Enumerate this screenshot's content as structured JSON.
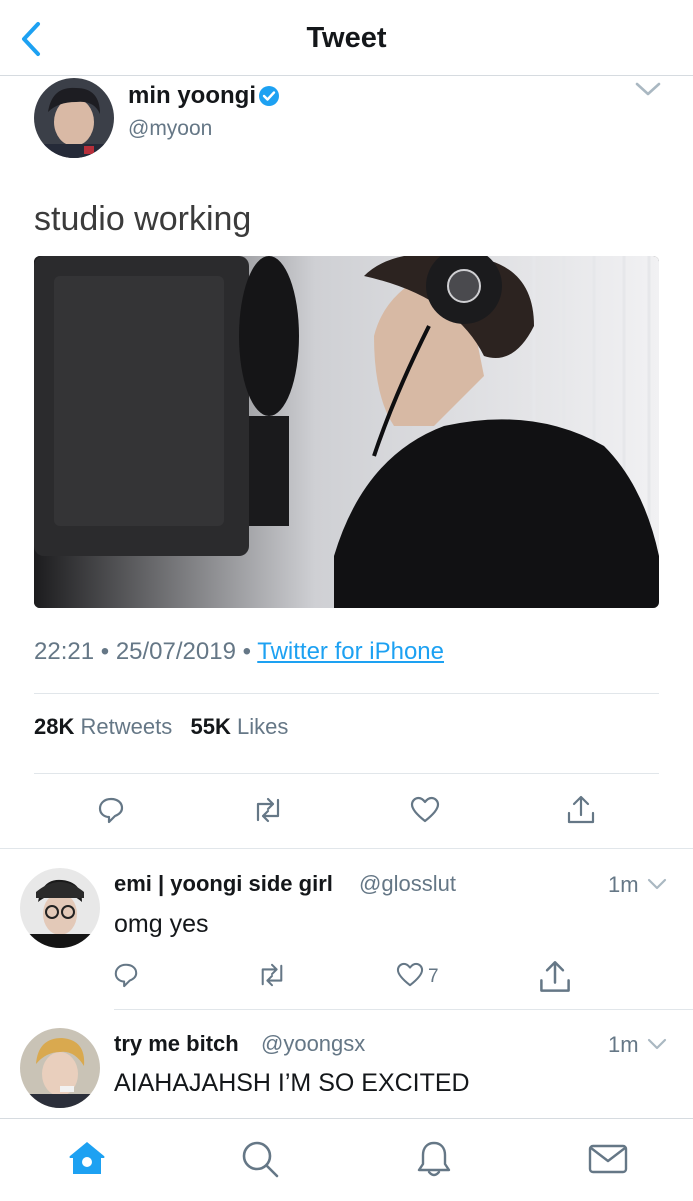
{
  "nav": {
    "title": "Tweet",
    "back_icon": "chevron-left-icon"
  },
  "tweet": {
    "author_name": "min yoongi",
    "author_handle": "@myoon",
    "text": "studio working",
    "time": "22:21",
    "date": "25/07/2019",
    "source": "Twitter for iPhone",
    "separator": "•",
    "retweets_count": "28K",
    "retweets_label": "Retweets",
    "likes_count": "55K",
    "likes_label": "Likes"
  },
  "replies": [
    {
      "name": "emi | yoongi side girl",
      "handle": "@glosslut",
      "time": "1m",
      "text": "omg yes",
      "like_count": "7"
    },
    {
      "name": "try me bitch",
      "handle": "@yoongsx",
      "time": "1m",
      "text": "AIAHAJAHSH I’M SO EXCITED"
    }
  ],
  "colors": {
    "accent": "#1da1f2",
    "muted": "#657786",
    "text": "#14171a",
    "divider": "#e1e6ea"
  }
}
